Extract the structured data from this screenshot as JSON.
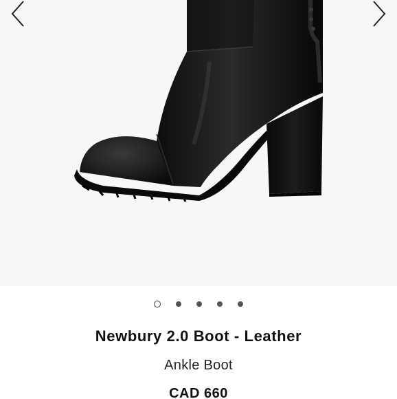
{
  "gallery": {
    "prev_icon": "chevron-left-icon",
    "next_icon": "chevron-right-icon",
    "image_subject": "black leather ankle boot with block heel",
    "dot_count": 5,
    "active_dot": 1
  },
  "product": {
    "title": "Newbury 2.0 Boot - Leather",
    "subtitle": "Ankle Boot",
    "price": "CAD 660"
  },
  "colors": {
    "background": "#f7f7f7",
    "boot": "#141414",
    "text": "#111111"
  }
}
